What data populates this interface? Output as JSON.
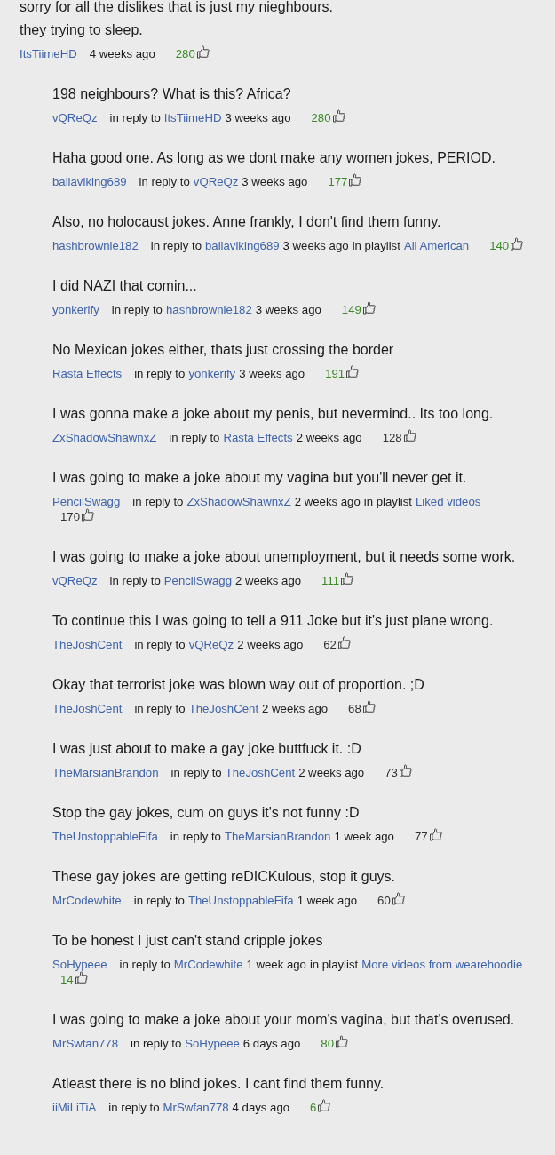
{
  "comment": {
    "text": "sorry for all the dislikes that is just my nieghbours.\nthey trying to sleep.",
    "author": "ItsTiimeHD",
    "time": "4 weeks ago",
    "likes": {
      "count": "280",
      "color": "#3b8a25"
    },
    "replies": [
      {
        "text": "198 neighbours? What is this? Africa?",
        "author": "vQReQz",
        "reply_label": "in reply to",
        "reply_to": "ItsTiimeHD",
        "time": "3 weeks ago",
        "likes": {
          "count": "280",
          "color": "#3b8a25"
        }
      },
      {
        "text": "Haha good one. As long as we dont make any women jokes, PERIOD.",
        "author": "ballaviking689",
        "reply_label": "in reply to",
        "reply_to": "vQReQz",
        "time": "3 weeks ago",
        "likes": {
          "count": "177",
          "color": "#3b8a25"
        }
      },
      {
        "text": "Also, no holocaust jokes. Anne frankly, I don't find them funny.",
        "author": "hashbrownie182",
        "reply_label": "in reply to",
        "reply_to": "ballaviking689",
        "time": "3 weeks ago",
        "playlist": {
          "label": "in playlist",
          "name": "All American"
        },
        "likes": {
          "count": "140",
          "color": "#3b8a25"
        }
      },
      {
        "text": "I did NAZI that comin...",
        "author": "yonkerify",
        "reply_label": "in reply to",
        "reply_to": "hashbrownie182",
        "time": "3 weeks ago",
        "likes": {
          "count": "149",
          "color": "#3b8a25"
        }
      },
      {
        "text": "No Mexican jokes either, thats just crossing the border",
        "author": "Rasta Effects",
        "reply_label": "in reply to",
        "reply_to": "yonkerify",
        "time": "3 weeks ago",
        "likes": {
          "count": "191",
          "color": "#3b8a25"
        }
      },
      {
        "text": "I was gonna make a joke about my penis, but nevermind.. Its too long.",
        "author": "ZxShadowShawnxZ",
        "reply_label": "in reply to",
        "reply_to": "Rasta Effects",
        "time": "2 weeks ago",
        "likes": {
          "count": "128",
          "color": "#333333"
        }
      },
      {
        "text": "I was going to make a joke about my vagina but you'll never get it.",
        "author": "PencilSwagg",
        "reply_label": "in reply to",
        "reply_to": "ZxShadowShawnxZ",
        "time": "2 weeks ago",
        "playlist": {
          "label": "in playlist",
          "name": "Liked videos"
        },
        "likes": {
          "count": "170",
          "color": "#333333"
        }
      },
      {
        "text": "I was going to make a joke about unemployment, but it needs some work.",
        "author": "vQReQz",
        "reply_label": "in reply to",
        "reply_to": "PencilSwagg",
        "time": "2 weeks ago",
        "likes": {
          "count": "111",
          "color": "#3b8a25"
        }
      },
      {
        "text": "To continue this I was going to tell a 911 Joke but it's just plane wrong.",
        "author": "TheJoshCent",
        "reply_label": "in reply to",
        "reply_to": "vQReQz",
        "time": "2 weeks ago",
        "likes": {
          "count": "62",
          "color": "#333333"
        }
      },
      {
        "text": "Okay that terrorist joke was blown way out of proportion. ;D",
        "author": "TheJoshCent",
        "reply_label": "in reply to",
        "reply_to": "TheJoshCent",
        "time": "2 weeks ago",
        "likes": {
          "count": "68",
          "color": "#333333"
        }
      },
      {
        "text": "I was just about to make a gay joke buttfuck it. :D",
        "author": "TheMarsianBrandon",
        "reply_label": "in reply to",
        "reply_to": "TheJoshCent",
        "time": "2 weeks ago",
        "likes": {
          "count": "73",
          "color": "#333333"
        }
      },
      {
        "text": "Stop the gay jokes, cum on guys it's not funny :D",
        "author": "TheUnstoppableFifa",
        "reply_label": "in reply to",
        "reply_to": "TheMarsianBrandon",
        "time": "1 week ago",
        "likes": {
          "count": "77",
          "color": "#333333"
        }
      },
      {
        "text": "These gay jokes are getting reDICKulous, stop it guys.",
        "author": "MrCodewhite",
        "reply_label": "in reply to",
        "reply_to": "TheUnstoppableFifa",
        "time": "1 week ago",
        "likes": {
          "count": "60",
          "color": "#333333"
        }
      },
      {
        "text": "To be honest I just can't stand cripple jokes",
        "author": "SoHypeee",
        "reply_label": "in reply to",
        "reply_to": "MrCodewhite",
        "time": "1 week ago",
        "playlist": {
          "label": "in playlist",
          "name": "More videos from wearehoodie"
        },
        "likes": {
          "count": "14",
          "color": "#3b8a25"
        }
      },
      {
        "text": "I was going to make a joke about your mom's vagina, but that's overused.",
        "author": "MrSwfan778",
        "reply_label": "in reply to",
        "reply_to": "SoHypeee",
        "time": "6 days ago",
        "likes": {
          "count": "80",
          "color": "#3b8a25"
        }
      },
      {
        "text": "Atleast there is no blind jokes. I cant find them funny.",
        "author": "iiMiLiTiA",
        "reply_label": "in reply to",
        "reply_to": "MrSwfan778",
        "time": "4 days ago",
        "likes": {
          "count": "6",
          "color": "#3b8a25"
        }
      }
    ]
  }
}
